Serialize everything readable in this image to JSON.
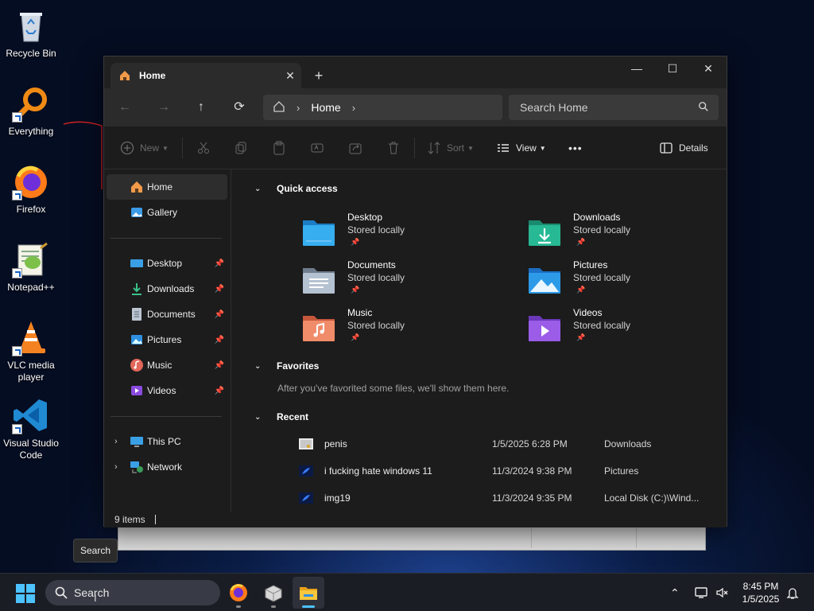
{
  "desktop": {
    "icons": [
      {
        "label": "Recycle Bin"
      },
      {
        "label": "Everything"
      },
      {
        "label": "Firefox"
      },
      {
        "label": "Notepad++"
      },
      {
        "label": "VLC media player"
      },
      {
        "label": "Visual Studio Code"
      }
    ]
  },
  "explorer": {
    "tab": {
      "title": "Home",
      "close": "✕",
      "new_tab": "+"
    },
    "window_controls": {
      "minimize": "—",
      "maximize": "☐",
      "close": "✕"
    },
    "breadcrumb": {
      "location": "Home"
    },
    "search_placeholder": "Search Home",
    "toolbar": {
      "new": "New",
      "sort": "Sort",
      "view": "View",
      "more": "•••",
      "details": "Details"
    },
    "sidebar": {
      "top": [
        {
          "label": "Home"
        },
        {
          "label": "Gallery"
        }
      ],
      "pinned": [
        {
          "label": "Desktop"
        },
        {
          "label": "Downloads"
        },
        {
          "label": "Documents"
        },
        {
          "label": "Pictures"
        },
        {
          "label": "Music"
        },
        {
          "label": "Videos"
        }
      ],
      "bottom": [
        {
          "label": "This PC"
        },
        {
          "label": "Network"
        }
      ]
    },
    "quick_access": {
      "heading": "Quick access",
      "items": [
        {
          "name": "Desktop",
          "status": "Stored locally"
        },
        {
          "name": "Downloads",
          "status": "Stored locally"
        },
        {
          "name": "Documents",
          "status": "Stored locally"
        },
        {
          "name": "Pictures",
          "status": "Stored locally"
        },
        {
          "name": "Music",
          "status": "Stored locally"
        },
        {
          "name": "Videos",
          "status": "Stored locally"
        }
      ]
    },
    "favorites": {
      "heading": "Favorites",
      "empty_message": "After you've favorited some files, we'll show them here."
    },
    "recent": {
      "heading": "Recent",
      "items": [
        {
          "name": "penis",
          "date": "1/5/2025 6:28 PM",
          "location": "Downloads"
        },
        {
          "name": "i fucking hate windows 11",
          "date": "11/3/2024 9:38 PM",
          "location": "Pictures"
        },
        {
          "name": "img19",
          "date": "11/3/2024 9:35 PM",
          "location": "Local Disk (C:)\\Wind..."
        }
      ]
    },
    "status": {
      "items": "9 items"
    }
  },
  "tooltip": "Search",
  "taskbar": {
    "search_placeholder": "Search",
    "time": "8:45 PM",
    "date": "1/5/2025"
  },
  "colors": {
    "accent": "#4cc2ff",
    "window_bg": "#1c1c1c",
    "addrbar_bg": "#2b2b2b"
  }
}
